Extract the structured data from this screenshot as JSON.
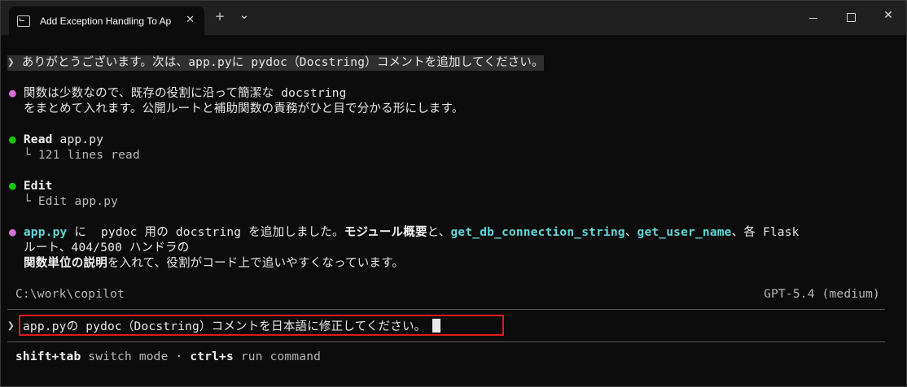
{
  "window": {
    "tab_title": "Add Exception Handling To Ap",
    "tab_close": "✕",
    "new_tab": "+",
    "dropdown": "⌄",
    "close": "✕"
  },
  "terminal": {
    "prompt_glyph": "❯",
    "user_message": "ありがとうございます。次は、app.pyに pydoc（Docstring）コメントを追加してください。",
    "bullet": "●",
    "assistant_note_line1": "関数は少数なので、既存の役割に沿って簡潔な docstring",
    "assistant_note_line2": "をまとめて入れます。公開ルートと補助関数の責務がひと目で分かる形にします。",
    "step_read": {
      "label": "Read",
      "target": "app.py",
      "detail": "└ 121 lines read"
    },
    "step_edit": {
      "label": "Edit",
      "detail": "└ Edit app.py"
    },
    "summary": {
      "p1": "app.py",
      "p2": " に  pydoc 用の docstring を追加しました。",
      "p3": "モジュール概要",
      "p4": "と、",
      "p5": "get_db_connection_string",
      "p6": "、",
      "p7": "get_user_name",
      "p8": "、各 Flask",
      "line2": "ルート、404/500 ハンドラの",
      "p9": "関数単位の説明",
      "p10": "を入れて、役割がコード上で追いやすくなっています。"
    },
    "cwd": "C:\\work\\copilot",
    "model": "GPT-5.4 (medium)",
    "input_value": "app.pyの pydoc（Docstring）コメントを日本語に修正してください。",
    "footer": {
      "k1": "shift+tab",
      "t1": " switch mode · ",
      "k2": "ctrl+s",
      "t2": " run command"
    }
  }
}
